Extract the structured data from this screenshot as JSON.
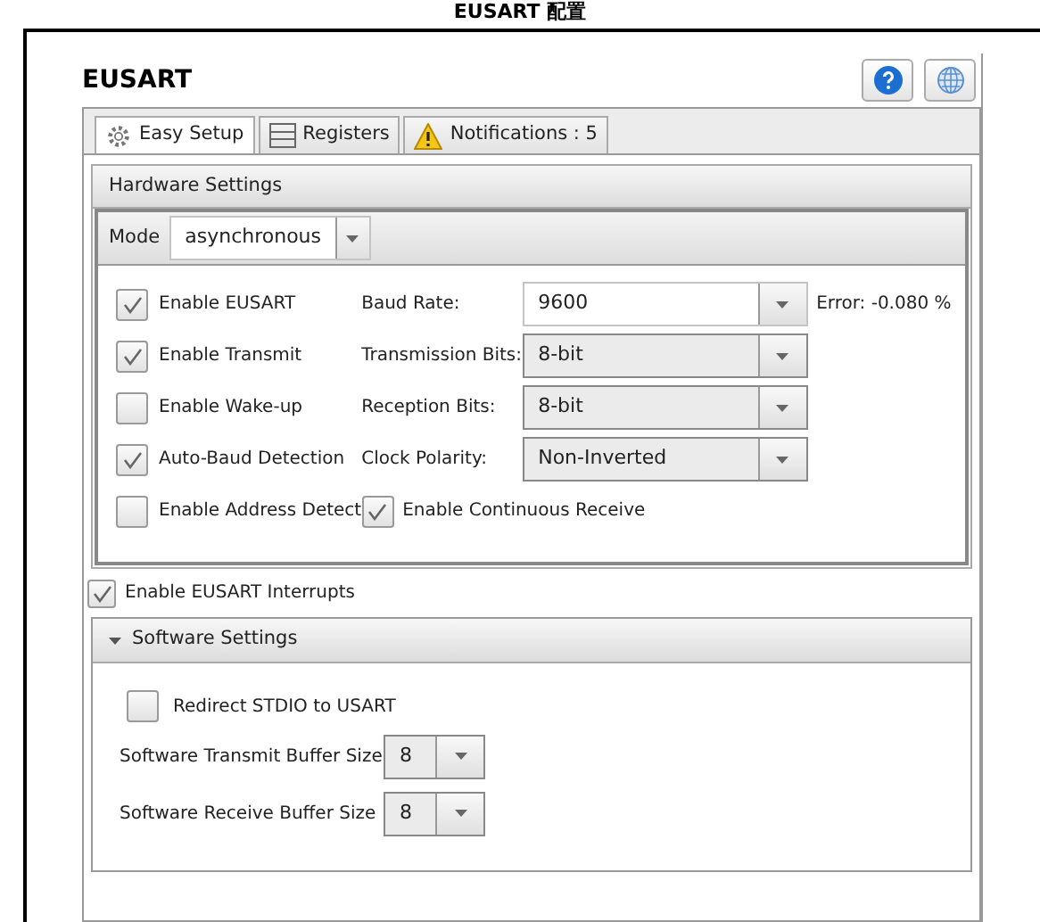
{
  "caption": "EUSART 配置",
  "title": "EUSART",
  "header_buttons": [
    {
      "kind": "help"
    },
    {
      "kind": "globe"
    }
  ],
  "tabs": [
    {
      "label": "Easy Setup",
      "kind": "gear",
      "selected": true
    },
    {
      "label": "Registers",
      "kind": "list",
      "selected": false
    },
    {
      "label": "Notifications : 5",
      "kind": "warning",
      "selected": false
    }
  ],
  "hardware_settings": {
    "title": "Hardware Settings",
    "mode": {
      "label": "Mode",
      "value": "asynchronous"
    },
    "checkboxes": [
      {
        "label": "Enable EUSART",
        "checked": true
      },
      {
        "label": "Enable Transmit",
        "checked": true
      },
      {
        "label": "Enable Wake-up",
        "checked": false
      },
      {
        "label": "Auto-Baud Detection",
        "checked": true
      },
      {
        "label": "Enable Address Detect",
        "checked": false
      }
    ],
    "fields": [
      {
        "label": "Baud Rate:",
        "value": "9600",
        "editable": true,
        "note": "Error: -0.080 %"
      },
      {
        "label": "Transmission Bits:",
        "value": "8-bit",
        "editable": false
      },
      {
        "label": "Reception Bits:",
        "value": "8-bit",
        "editable": false
      },
      {
        "label": "Clock Polarity:",
        "value": "Non-Inverted",
        "editable": false
      }
    ],
    "continuous_receive": {
      "label": "Enable Continuous Receive",
      "checked": true
    }
  },
  "interrupts": {
    "label": "Enable EUSART Interrupts",
    "checked": true
  },
  "software_settings": {
    "title": "Software Settings",
    "expanded": true,
    "redirect": {
      "label": "Redirect STDIO to USART",
      "checked": false
    },
    "buffers": [
      {
        "label": "Software Transmit Buffer Size",
        "value": "8"
      },
      {
        "label": "Software Receive Buffer Size",
        "value": "8"
      }
    ]
  }
}
